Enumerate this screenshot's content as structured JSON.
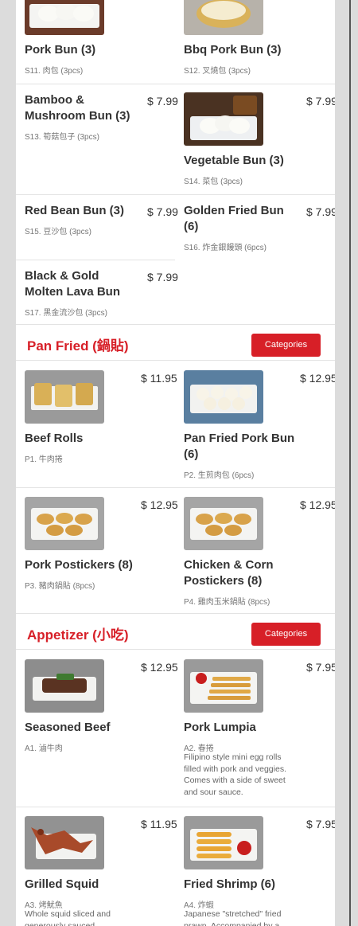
{
  "sections": {
    "pan_fried": {
      "title": "Pan Fried (鍋貼)",
      "button": "Categories"
    },
    "appetizer": {
      "title": "Appetizer (小吃)",
      "button": "Categories"
    }
  },
  "items": {
    "s11": {
      "name": "Pork Bun (3)",
      "code": "S11. 肉包 (3pcs)"
    },
    "s12": {
      "name": "Bbq Pork Bun (3)",
      "code": "S12. 叉燒包 (3pcs)"
    },
    "s13": {
      "name": "Bamboo & Mushroom Bun (3)",
      "code": "S13. 筍菇包子 (3pcs)",
      "price": "$ 7.99"
    },
    "s14": {
      "name": "Vegetable Bun (3)",
      "code": "S14. 菜包 (3pcs)",
      "price": "$ 7.99"
    },
    "s15": {
      "name": "Red Bean Bun (3)",
      "code": "S15. 豆沙包 (3pcs)",
      "price": "$ 7.99"
    },
    "s16": {
      "name": "Golden Fried Bun (6)",
      "code": "S16. 炸金銀饅頭 (6pcs)",
      "price": "$ 7.99"
    },
    "s17": {
      "name": "Black & Gold Molten Lava Bun",
      "code": "S17. 黑金流沙包 (3pcs)",
      "price": "$ 7.99"
    },
    "p1": {
      "name": "Beef Rolls",
      "code": "P1. 牛肉捲",
      "price": "$ 11.95"
    },
    "p2": {
      "name": "Pan Fried Pork Bun (6)",
      "code": "P2. 生煎肉包 (6pcs)",
      "price": "$ 12.95"
    },
    "p3": {
      "name": "Pork Postickers (8)",
      "code": "P3. 豬肉鍋貼 (8pcs)",
      "price": "$ 12.95"
    },
    "p4": {
      "name": "Chicken & Corn Postickers (8)",
      "code": "P4. 雞肉玉米鍋貼 (8pcs)",
      "price": "$ 12.95"
    },
    "a1": {
      "name": "Seasoned Beef",
      "code": "A1. 滷牛肉",
      "price": "$ 12.95"
    },
    "a2": {
      "name": "Pork Lumpia",
      "code": "A2. 春捲",
      "desc": "Filipino style mini egg rolls filled with pork and veggies. Comes with a side of sweet and sour sauce.",
      "price": "$ 7.95"
    },
    "a3": {
      "name": "Grilled Squid",
      "code": "A3. 烤魷魚",
      "desc": "Whole squid sliced and generously sauced",
      "price": "$ 11.95"
    },
    "a4": {
      "name": "Fried Shrimp (6)",
      "code": "A4. 炸蝦",
      "desc": "Japanese \"stretched\" fried prawn. Accompanied by a",
      "price": "$ 7.95"
    }
  }
}
